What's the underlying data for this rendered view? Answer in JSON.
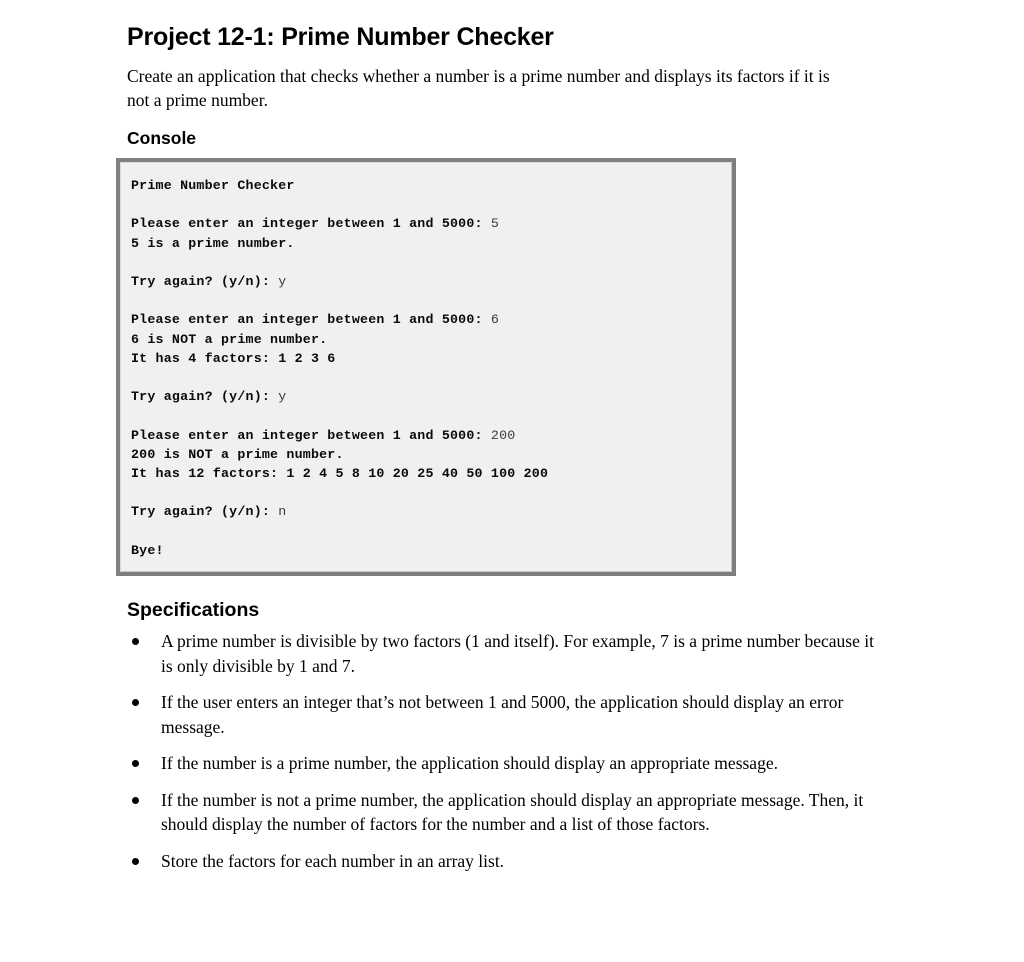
{
  "document": {
    "title": "Project 12-1: Prime Number Checker",
    "intro": "Create an application that checks whether a number is a prime number and displays its factors if it is not a prime number.",
    "console_heading": "Console",
    "specifications_heading": "Specifications"
  },
  "console": {
    "background_color": "#f0f0f0",
    "border_color": "#808080",
    "lines": [
      {
        "output": "Prime Number Checker",
        "input": ""
      },
      {
        "output": "",
        "input": ""
      },
      {
        "output": "Please enter an integer between 1 and 5000: ",
        "input": "5"
      },
      {
        "output": "5 is a prime number.",
        "input": ""
      },
      {
        "output": "",
        "input": ""
      },
      {
        "output": "Try again? (y/n): ",
        "input": "y"
      },
      {
        "output": "",
        "input": ""
      },
      {
        "output": "Please enter an integer between 1 and 5000: ",
        "input": "6"
      },
      {
        "output": "6 is NOT a prime number.",
        "input": ""
      },
      {
        "output": "It has 4 factors: 1 2 3 6",
        "input": ""
      },
      {
        "output": "",
        "input": ""
      },
      {
        "output": "Try again? (y/n): ",
        "input": "y"
      },
      {
        "output": "",
        "input": ""
      },
      {
        "output": "Please enter an integer between 1 and 5000: ",
        "input": "200"
      },
      {
        "output": "200 is NOT a prime number.",
        "input": ""
      },
      {
        "output": "It has 12 factors: 1 2 4 5 8 10 20 25 40 50 100 200",
        "input": ""
      },
      {
        "output": "",
        "input": ""
      },
      {
        "output": "Try again? (y/n): ",
        "input": "n"
      },
      {
        "output": "",
        "input": ""
      },
      {
        "output": "Bye!",
        "input": ""
      }
    ]
  },
  "specifications": [
    "A prime number is divisible by two factors (1 and itself). For example, 7 is a prime number because it is only divisible by 1 and 7.",
    "If the user enters an integer that’s not between 1 and 5000, the application should display an error message.",
    "If the number is a prime number, the application should display an appropriate message.",
    "If the number is not a prime number, the application should display an appropriate message. Then, it should display the number of factors for the number and a list of those factors.",
    "Store the factors for each number in an array list."
  ]
}
